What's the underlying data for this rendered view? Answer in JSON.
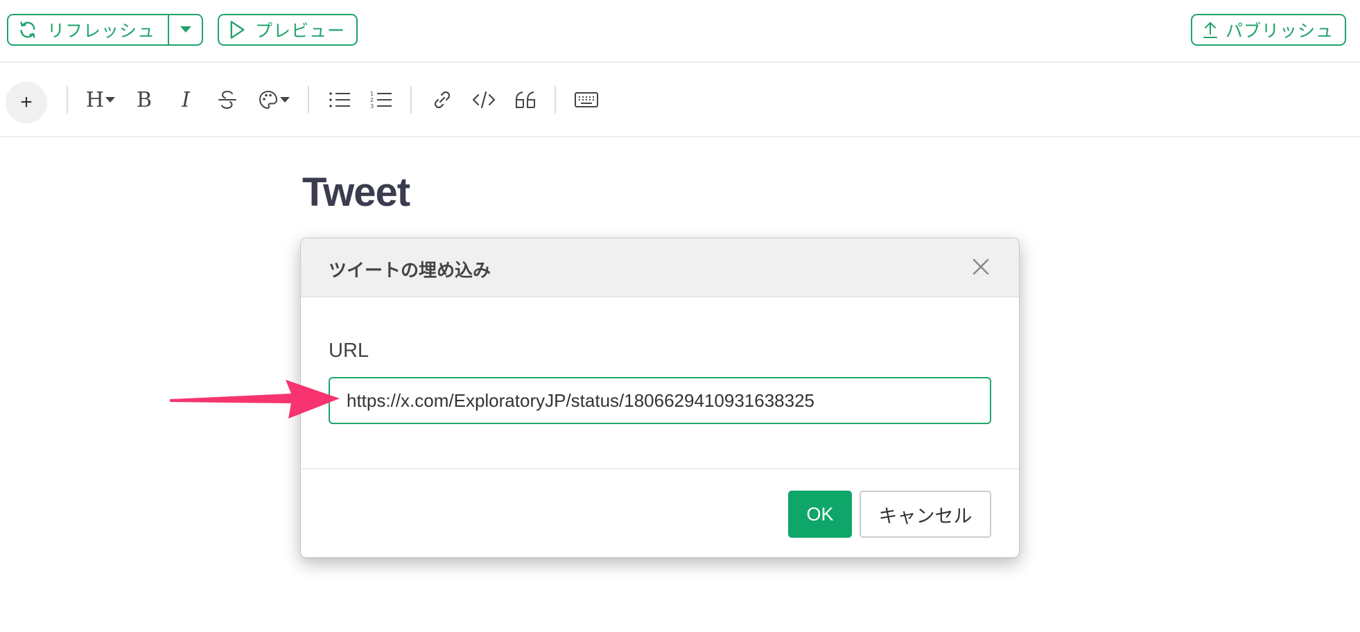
{
  "header": {
    "refresh_label": "リフレッシュ",
    "preview_label": "プレビュー",
    "publish_label": "パブリッシュ",
    "accent_color": "#1fa36a"
  },
  "toolbar": {
    "plus_label": "+",
    "heading_label": "H",
    "bold_label": "B",
    "italic_label": "I",
    "icons": [
      "plus-icon",
      "heading-icon",
      "bold-icon",
      "italic-icon",
      "strikethrough-icon",
      "palette-icon",
      "bullet-list-icon",
      "numbered-list-icon",
      "link-icon",
      "code-icon",
      "quote-icon",
      "keyboard-icon"
    ]
  },
  "document": {
    "title": "Tweet"
  },
  "dialog": {
    "title": "ツイートの埋め込み",
    "url_label": "URL",
    "url_value": "https://x.com/ExploratoryJP/status/1806629410931638325",
    "ok_label": "OK",
    "cancel_label": "キャンセル",
    "ok_color": "#0fa66a"
  },
  "annotation": {
    "arrow_color": "#f7346f"
  }
}
